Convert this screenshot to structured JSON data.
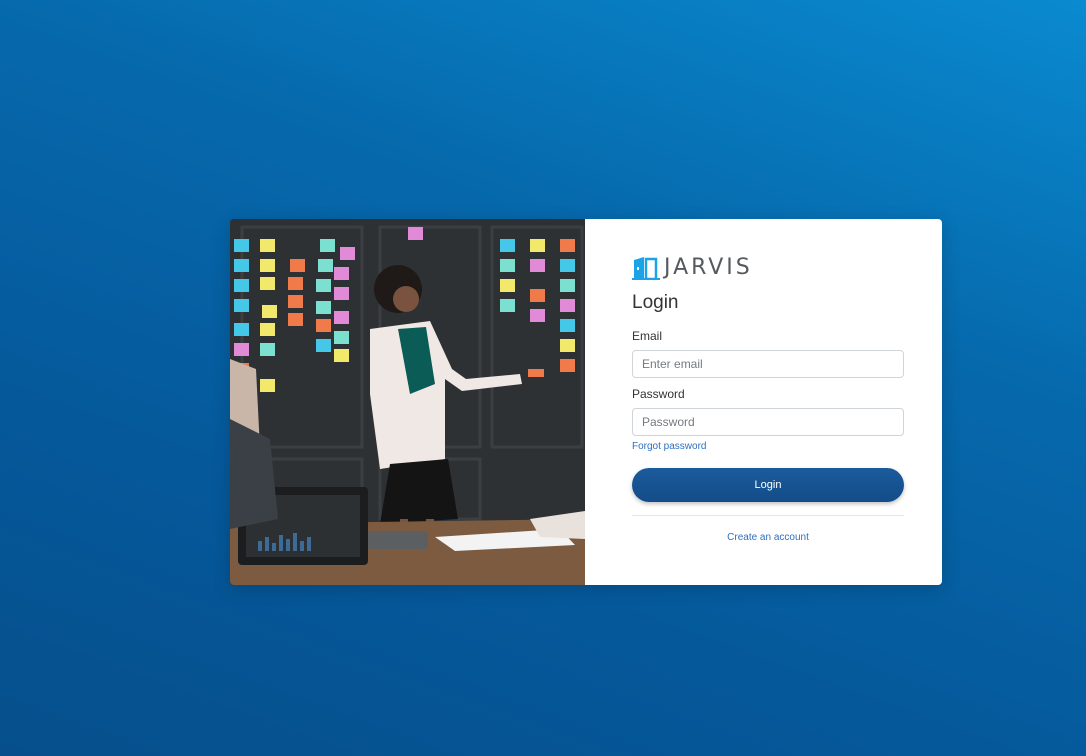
{
  "brand": {
    "name": "JARVIS",
    "logo_icon": "door-icon",
    "logo_color": "#1aa3e6"
  },
  "login_form": {
    "title": "Login",
    "email_label": "Email",
    "email_placeholder": "Enter email",
    "email_value": "",
    "password_label": "Password",
    "password_placeholder": "Password",
    "password_value": "",
    "forgot_password_link": "Forgot password",
    "submit_label": "Login",
    "create_account_link": "Create an account"
  },
  "hero_image": {
    "subject": "office-meeting-sticky-notes-photo"
  },
  "colors": {
    "background": "#0669ac",
    "button": "#17548f",
    "link": "#2f6fc0"
  }
}
